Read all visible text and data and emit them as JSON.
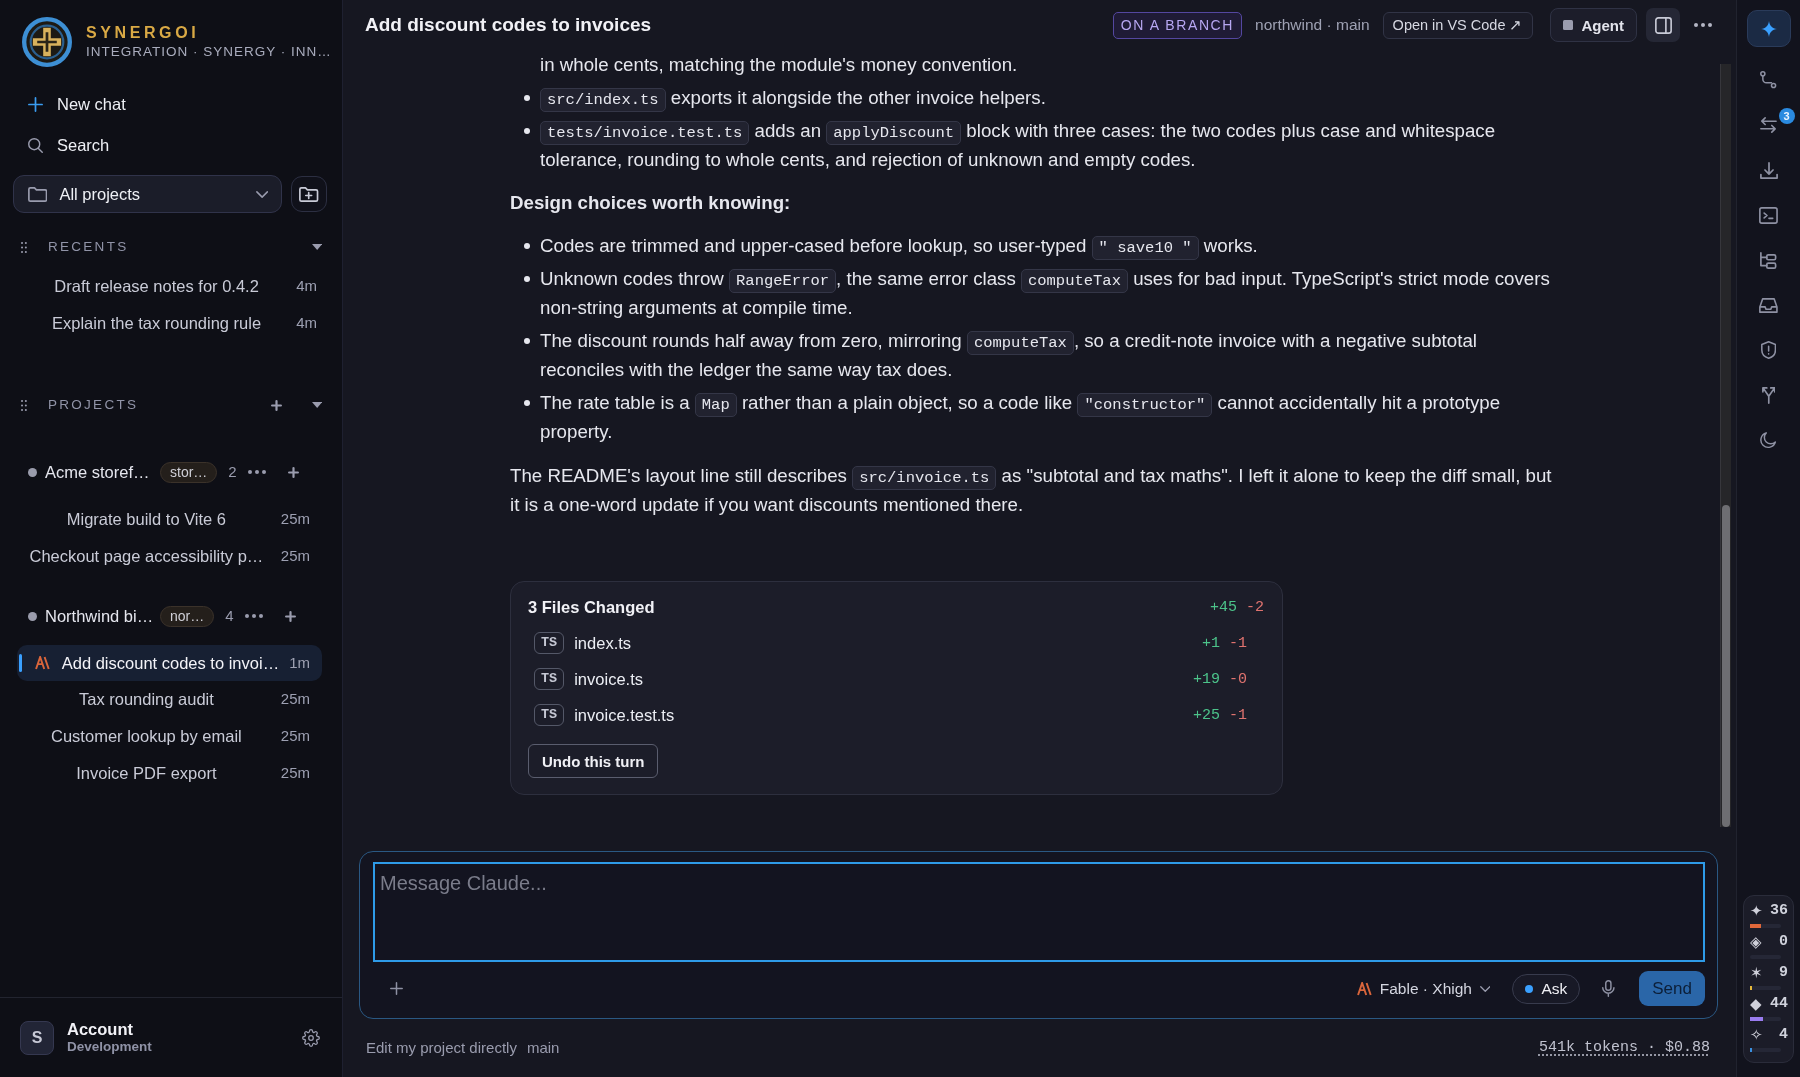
{
  "sidebar": {
    "brand": {
      "name": "SYNERGOI",
      "tagline": "INTEGRATION · SYNERGY · INN…"
    },
    "actions": [
      {
        "kind": "new",
        "label": "New chat"
      },
      {
        "kind": "search",
        "label": "Search"
      }
    ],
    "project_filter": {
      "value": "All projects"
    },
    "recents": {
      "title": "RECENTS",
      "items": [
        {
          "title": "Draft release notes for 0.4.2",
          "age": "4m",
          "selected": false
        },
        {
          "title": "Explain the tax rounding rule",
          "age": "4m",
          "selected": false
        }
      ]
    },
    "projects": {
      "title": "PROJECTS",
      "items": [
        {
          "name": "Acme storef…",
          "tag": "stor…",
          "count": "2",
          "sessions": [
            {
              "title": "Migrate build to Vite 6",
              "age": "25m",
              "selected": false
            },
            {
              "title": "Checkout page accessibility p…",
              "age": "25m",
              "selected": false
            }
          ]
        },
        {
          "name": "Northwind bi…",
          "tag": "nor…",
          "count": "4",
          "sessions": [
            {
              "title": "Add discount codes to invoi…",
              "age": "1m",
              "selected": true
            },
            {
              "title": "Tax rounding audit",
              "age": "25m",
              "selected": false
            },
            {
              "title": "Customer lookup by email",
              "age": "25m",
              "selected": false
            },
            {
              "title": "Invoice PDF export",
              "age": "25m",
              "selected": false
            }
          ]
        }
      ]
    },
    "account": {
      "initial": "S",
      "name": "Account",
      "plan": "Development"
    }
  },
  "header": {
    "title": "Add discount codes to invoices",
    "badge": "ON A BRANCH",
    "repo": "northwind · main",
    "open_button": "Open in VS Code ↗",
    "mode_button": "Agent"
  },
  "message": {
    "blocks": [
      {
        "kind": "list",
        "items": [
          {
            "kind": "continued",
            "runs": [
              {
                "kind": "text",
                "text": "in whole cents, matching the module's money convention."
              }
            ]
          },
          {
            "kind": "bullet",
            "runs": [
              {
                "kind": "code",
                "text": "src/index.ts"
              },
              {
                "kind": "text",
                "text": " exports it alongside the other invoice helpers."
              }
            ]
          },
          {
            "kind": "bullet",
            "runs": [
              {
                "kind": "code",
                "text": "tests/invoice.test.ts"
              },
              {
                "kind": "text",
                "text": " adds an "
              },
              {
                "kind": "code",
                "text": "applyDiscount"
              },
              {
                "kind": "text",
                "text": " block with three cases: the two codes plus case and whitespace tolerance, rounding to whole cents, and rejection of unknown and empty codes."
              }
            ]
          }
        ]
      },
      {
        "kind": "heading",
        "text": "Design choices worth knowing:"
      },
      {
        "kind": "list",
        "items": [
          {
            "kind": "bullet",
            "runs": [
              {
                "kind": "text",
                "text": "Codes are trimmed and upper-cased before lookup, so user-typed "
              },
              {
                "kind": "code",
                "text": "\" save10 \""
              },
              {
                "kind": "text",
                "text": " works."
              }
            ]
          },
          {
            "kind": "bullet",
            "runs": [
              {
                "kind": "text",
                "text": "Unknown codes throw "
              },
              {
                "kind": "code",
                "text": "RangeError"
              },
              {
                "kind": "text",
                "text": ", the same error class "
              },
              {
                "kind": "code",
                "text": "computeTax"
              },
              {
                "kind": "text",
                "text": " uses for bad input. TypeScript's strict mode covers non-string arguments at compile time."
              }
            ]
          },
          {
            "kind": "bullet",
            "runs": [
              {
                "kind": "text",
                "text": "The discount rounds half away from zero, mirroring "
              },
              {
                "kind": "code",
                "text": "computeTax"
              },
              {
                "kind": "text",
                "text": ", so a credit-note invoice with a negative subtotal reconciles with the ledger the same way tax does."
              }
            ]
          },
          {
            "kind": "bullet",
            "runs": [
              {
                "kind": "text",
                "text": "The rate table is a "
              },
              {
                "kind": "code",
                "text": "Map"
              },
              {
                "kind": "text",
                "text": " rather than a plain object, so a code like "
              },
              {
                "kind": "code",
                "text": "\"constructor\""
              },
              {
                "kind": "text",
                "text": " cannot accidentally hit a prototype property."
              }
            ]
          }
        ]
      },
      {
        "kind": "paragraph",
        "runs": [
          {
            "kind": "text",
            "text": "The README's layout line still describes "
          },
          {
            "kind": "code",
            "text": "src/invoice.ts"
          },
          {
            "kind": "text",
            "text": " as \"subtotal and tax maths\". I left it alone to keep the diff small, but it is a one-word update if you want discounts mentioned there."
          }
        ]
      }
    ]
  },
  "files_changed": {
    "title": "3 Files Changed",
    "added": "+45",
    "removed": "-2",
    "files": [
      {
        "type": "TS",
        "name": "index.ts",
        "added": "+1",
        "removed": "-1"
      },
      {
        "type": "TS",
        "name": "invoice.ts",
        "added": "+19",
        "removed": "-0"
      },
      {
        "type": "TS",
        "name": "invoice.test.ts",
        "added": "+25",
        "removed": "-1"
      }
    ],
    "undo_button": "Undo this turn"
  },
  "composer": {
    "placeholder": "Message Claude...",
    "model": "Fable · Xhigh",
    "mode": "Ask",
    "send_button": "Send"
  },
  "status_bar": {
    "mode": "Edit my project directly",
    "branch": "main",
    "usage": "541k tokens · $0.88"
  },
  "rail": {
    "tools": [
      {
        "kind": "assistant",
        "selected": true
      },
      {
        "kind": "changes",
        "selected": false
      },
      {
        "kind": "sync",
        "selected": false,
        "badge": "3"
      },
      {
        "kind": "download",
        "selected": false
      },
      {
        "kind": "terminal",
        "selected": false
      },
      {
        "kind": "structure",
        "selected": false
      },
      {
        "kind": "inbox",
        "selected": false
      },
      {
        "kind": "security",
        "selected": false
      },
      {
        "kind": "branches",
        "selected": false
      },
      {
        "kind": "theme",
        "selected": false
      }
    ],
    "meters": [
      {
        "symbol": "✦",
        "value": "36",
        "level": 0.35,
        "color": "#e0673a"
      },
      {
        "symbol": "◈",
        "value": "0",
        "level": 0
      },
      {
        "symbol": "✶",
        "value": "9",
        "level": 0.08,
        "color": "#e5b93a"
      },
      {
        "symbol": "◆",
        "value": "44",
        "level": 0.43,
        "color": "#9a7cf0"
      },
      {
        "symbol": "✧",
        "value": "4",
        "level": 0.07,
        "color": "#3a8fe0"
      }
    ]
  }
}
